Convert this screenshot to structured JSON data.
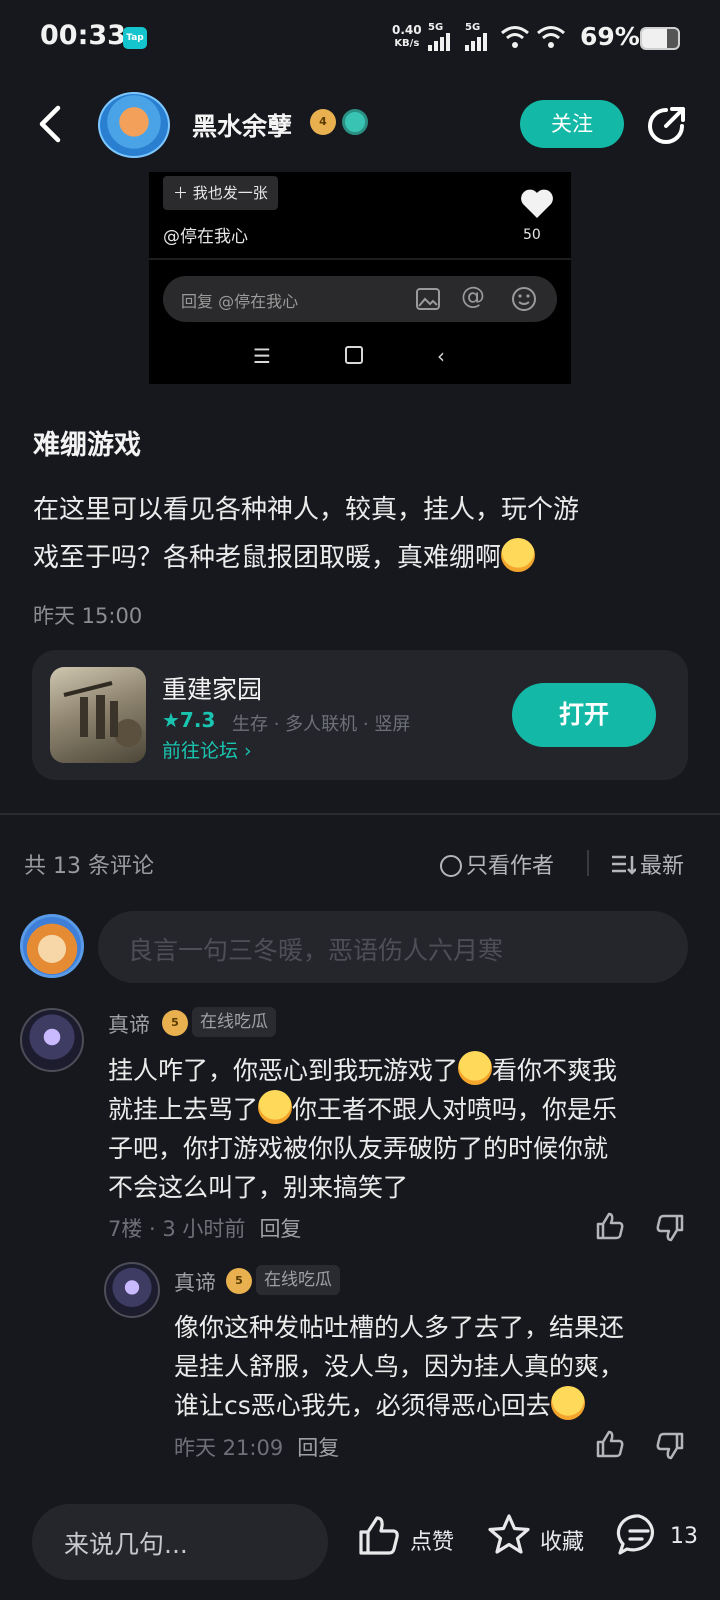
{
  "status_bar": {
    "time": "00:33",
    "app_badge": "Tap",
    "net_speed_value": "0.40",
    "net_speed_unit": "KB/s",
    "signal_1": "5G",
    "signal_2": "5G",
    "battery_percent": "69%",
    "battery_level": 0.69
  },
  "header": {
    "author_name": "黑水余孽",
    "author_level": "4",
    "follow_label": "关注"
  },
  "embedded_screenshot": {
    "add_label": "我也发一张",
    "mention": "@停在我心",
    "like_count": "50",
    "reply_placeholder": "回复 @停在我心"
  },
  "post": {
    "title": "难绷游戏",
    "body_line1": "在这里可以看见各种神人，较真，挂人，玩个游",
    "body_line2": "戏至于吗？各种老鼠报团取暖，真难绷啊",
    "time": "昨天 15:00"
  },
  "game_card": {
    "name": "重建家园",
    "rating": "★7.3",
    "tags": "生存 · 多人联机 · 竖屏",
    "forum_link": "前往论坛",
    "open_label": "打开"
  },
  "comments_header": {
    "count_label": "共 13 条评论",
    "author_only_label": "只看作者",
    "sort_label": "最新"
  },
  "comment_input": {
    "placeholder": "良言一句三冬暖，恶语伤人六月寒"
  },
  "comments": [
    {
      "name": "真谛",
      "level": "5",
      "tag": "在线吃瓜",
      "lines": [
        "挂人咋了，你恶心到我玩游戏了",
        "看你不爽我",
        "就挂上去骂了",
        "你王者不跟人对喷吗，你是乐",
        "子吧，你打游戏被你队友弄破防了的时候你就",
        "不会这么叫了，别来搞笑了"
      ],
      "meta": "7楼 · 3 小时前",
      "reply_label": "回复"
    },
    {
      "name": "真谛",
      "level": "5",
      "tag": "在线吃瓜",
      "lines": [
        "像你这种发帖吐槽的人多了去了，结果还",
        "是挂人舒服，没人鸟，因为挂人真的爽，",
        "谁让cs恶心我先，必须得恶心回去"
      ],
      "meta": "昨天 21:09",
      "reply_label": "回复"
    }
  ],
  "bottom_bar": {
    "input_placeholder": "来说几句...",
    "like_label": "点赞",
    "favorite_label": "收藏",
    "comment_count": "13"
  },
  "colors": {
    "background": "#17181d",
    "accent": "#13b8a6",
    "card": "#24252b"
  }
}
